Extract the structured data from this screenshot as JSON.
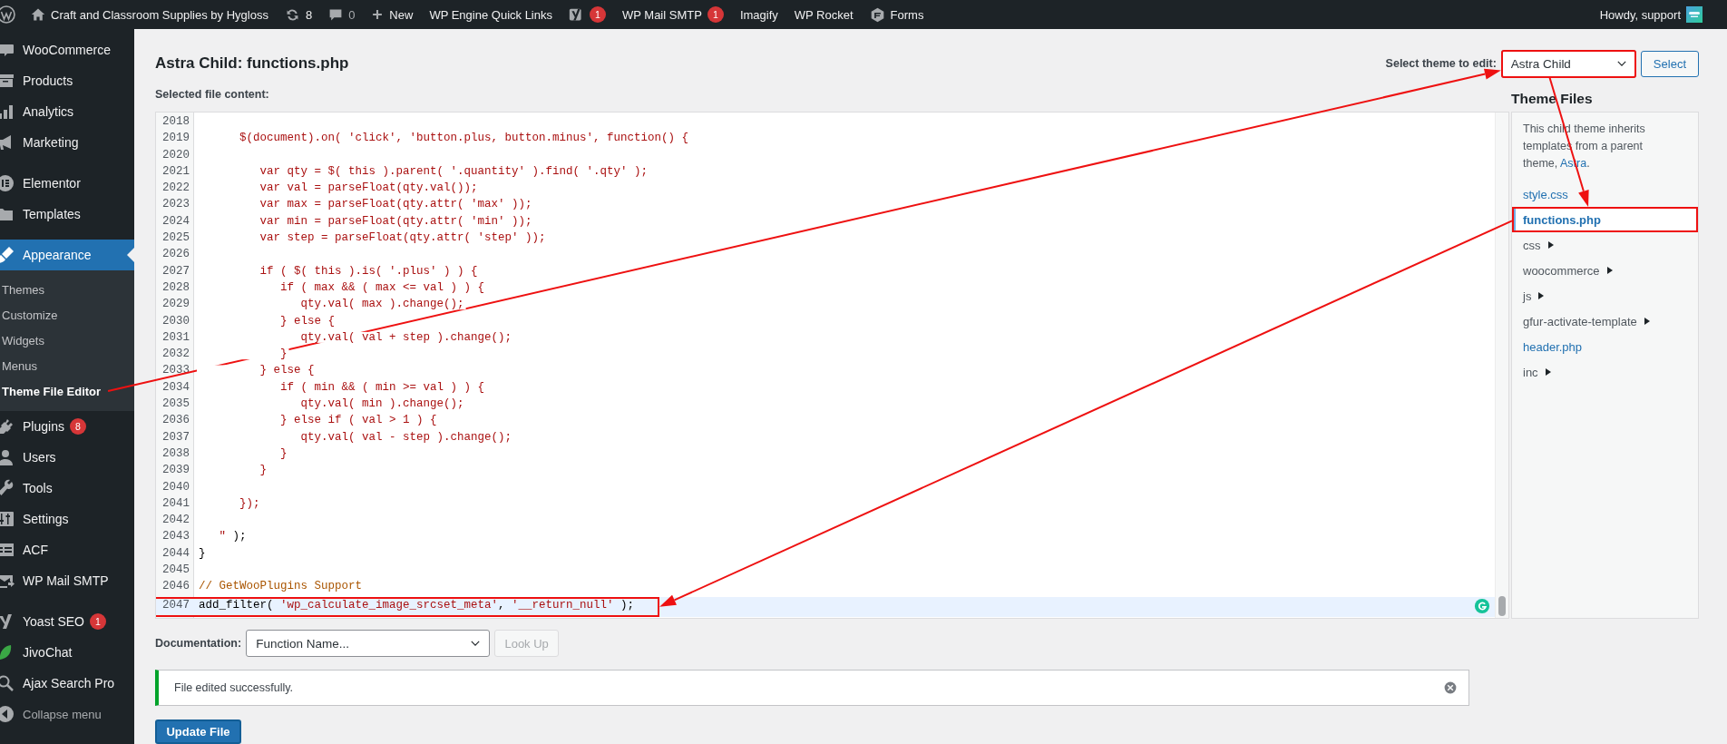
{
  "admin_bar": {
    "site_name": "Craft and Classroom Supplies by Hygloss",
    "updates": "8",
    "comments": "0",
    "new_label": "New",
    "menu": [
      {
        "label": "WP Engine Quick Links"
      },
      {
        "badge": "1"
      },
      {
        "label": "WP Mail SMTP",
        "badge": "1"
      },
      {
        "label": "Imagify"
      },
      {
        "label": "WP Rocket"
      },
      {
        "label": "Forms"
      }
    ],
    "greeting": "Howdy, support"
  },
  "sidebar": {
    "sections": [
      {
        "items": [
          {
            "label": "WooCommerce",
            "selected": false
          },
          {
            "label": "Products",
            "selected": false
          },
          {
            "label": "Analytics",
            "selected": false
          },
          {
            "label": "Marketing",
            "selected": false
          }
        ]
      },
      {
        "items": [
          {
            "label": "Elementor",
            "selected": false
          },
          {
            "label": "Templates",
            "selected": false
          }
        ]
      },
      {
        "items": [
          {
            "label": "Appearance",
            "selected": true,
            "submenu": [
              {
                "label": "Themes",
                "selected": false
              },
              {
                "label": "Customize",
                "selected": false
              },
              {
                "label": "Widgets",
                "selected": false
              },
              {
                "label": "Menus",
                "selected": false
              },
              {
                "label": "Theme File Editor",
                "selected": true
              }
            ]
          },
          {
            "label": "Plugins",
            "selected": false,
            "badge": "8"
          },
          {
            "label": "Users",
            "selected": false
          },
          {
            "label": "Tools",
            "selected": false
          },
          {
            "label": "Settings",
            "selected": false
          },
          {
            "label": "ACF",
            "selected": false
          },
          {
            "label": "WP Mail SMTP",
            "selected": false
          }
        ]
      },
      {
        "items": [
          {
            "label": "Yoast SEO",
            "selected": false,
            "badge": "1"
          },
          {
            "label": "JivoChat",
            "selected": false
          },
          {
            "label": "Ajax Search Pro",
            "selected": false
          }
        ]
      }
    ],
    "collapse_label": "Collapse menu"
  },
  "page": {
    "title": "Astra Child: functions.php",
    "content_label": "Selected file content:",
    "theme_select": {
      "label": "Select theme to edit:",
      "value": "Astra Child",
      "highlighted": true
    },
    "select_button": "Select"
  },
  "editor": {
    "lines": [
      {
        "number": "2018",
        "active": false,
        "highlighted": false
      },
      {
        "number": "2019",
        "active": false,
        "highlighted": false,
        "segments": [
          {
            "kind": "string",
            "text": "      $(document).on( 'click', 'button.plus, button.minus', function() {"
          }
        ]
      },
      {
        "number": "2020",
        "active": false,
        "highlighted": false
      },
      {
        "number": "2021",
        "active": false,
        "highlighted": false,
        "segments": [
          {
            "kind": "string",
            "text": "         var qty = $( this ).parent( '.quantity' ).find( '.qty' );"
          }
        ]
      },
      {
        "number": "2022",
        "active": false,
        "highlighted": false,
        "segments": [
          {
            "kind": "string",
            "text": "         var val = parseFloat(qty.val());"
          }
        ]
      },
      {
        "number": "2023",
        "active": false,
        "highlighted": false,
        "segments": [
          {
            "kind": "string",
            "text": "         var max = parseFloat(qty.attr( 'max' ));"
          }
        ]
      },
      {
        "number": "2024",
        "active": false,
        "highlighted": false,
        "segments": [
          {
            "kind": "string",
            "text": "         var min = parseFloat(qty.attr( 'min' ));"
          }
        ]
      },
      {
        "number": "2025",
        "active": false,
        "highlighted": false,
        "segments": [
          {
            "kind": "string",
            "text": "         var step = parseFloat(qty.attr( 'step' ));"
          }
        ]
      },
      {
        "number": "2026",
        "active": false,
        "highlighted": false
      },
      {
        "number": "2027",
        "active": false,
        "highlighted": false,
        "segments": [
          {
            "kind": "string",
            "text": "         if ( $( this ).is( '.plus' ) ) {"
          }
        ]
      },
      {
        "number": "2028",
        "active": false,
        "highlighted": false,
        "segments": [
          {
            "kind": "string",
            "text": "            if ( max && ( max <= val ) ) {"
          }
        ]
      },
      {
        "number": "2029",
        "active": false,
        "highlighted": false,
        "segments": [
          {
            "kind": "string",
            "text": "               qty.val( max ).change();"
          }
        ]
      },
      {
        "number": "2030",
        "active": false,
        "highlighted": false,
        "segments": [
          {
            "kind": "string",
            "text": "            } else {"
          }
        ]
      },
      {
        "number": "2031",
        "active": false,
        "highlighted": false,
        "segments": [
          {
            "kind": "string",
            "text": "               qty.val( val + step ).change();"
          }
        ]
      },
      {
        "number": "2032",
        "active": false,
        "highlighted": false,
        "segments": [
          {
            "kind": "string",
            "text": "            }"
          }
        ]
      },
      {
        "number": "2033",
        "active": false,
        "highlighted": false,
        "segments": [
          {
            "kind": "string",
            "text": "         } else {"
          }
        ]
      },
      {
        "number": "2034",
        "active": false,
        "highlighted": false,
        "segments": [
          {
            "kind": "string",
            "text": "            if ( min && ( min >= val ) ) {"
          }
        ]
      },
      {
        "number": "2035",
        "active": false,
        "highlighted": false,
        "segments": [
          {
            "kind": "string",
            "text": "               qty.val( min ).change();"
          }
        ]
      },
      {
        "number": "2036",
        "active": false,
        "highlighted": false,
        "segments": [
          {
            "kind": "string",
            "text": "            } else if ( val > 1 ) {"
          }
        ]
      },
      {
        "number": "2037",
        "active": false,
        "highlighted": false,
        "segments": [
          {
            "kind": "string",
            "text": "               qty.val( val - step ).change();"
          }
        ]
      },
      {
        "number": "2038",
        "active": false,
        "highlighted": false,
        "segments": [
          {
            "kind": "string",
            "text": "            }"
          }
        ]
      },
      {
        "number": "2039",
        "active": false,
        "highlighted": false,
        "segments": [
          {
            "kind": "string",
            "text": "         }"
          }
        ]
      },
      {
        "number": "2040",
        "active": false,
        "highlighted": false
      },
      {
        "number": "2041",
        "active": false,
        "highlighted": false,
        "segments": [
          {
            "kind": "string",
            "text": "      });"
          }
        ]
      },
      {
        "number": "2042",
        "active": false,
        "highlighted": false
      },
      {
        "number": "2043",
        "active": false,
        "highlighted": false,
        "segments": [
          {
            "kind": "string",
            "text": "   \""
          },
          {
            "kind": "plain",
            "text": " );"
          }
        ]
      },
      {
        "number": "2044",
        "active": false,
        "highlighted": false,
        "segments": [
          {
            "kind": "plain",
            "text": "}"
          }
        ]
      },
      {
        "number": "2045",
        "active": false,
        "highlighted": false
      },
      {
        "number": "2046",
        "active": false,
        "highlighted": false,
        "segments": [
          {
            "kind": "comment",
            "text": "// GetWooPlugins Support"
          }
        ]
      },
      {
        "number": "2047",
        "active": true,
        "highlighted": true,
        "segments": [
          {
            "kind": "plain",
            "text": "add_filter( "
          },
          {
            "kind": "string",
            "text": "'wp_calculate_image_srcset_meta'"
          },
          {
            "kind": "plain",
            "text": ", "
          },
          {
            "kind": "string",
            "text": "'__return_null'"
          },
          {
            "kind": "plain",
            "text": " );"
          }
        ]
      }
    ]
  },
  "theme_files": {
    "title": "Theme Files",
    "note_before": "This child theme inherits templates from a parent theme, ",
    "note_link": "Astra",
    "note_after": ".",
    "files": [
      {
        "label": "style.css",
        "kind": "file",
        "selected": false,
        "highlighted": false
      },
      {
        "label": "functions.php",
        "kind": "file",
        "selected": true,
        "highlighted": true
      },
      {
        "label": "css",
        "kind": "folder",
        "expanded": false,
        "highlighted": false
      },
      {
        "label": "woocommerce",
        "kind": "folder",
        "expanded": false,
        "highlighted": false
      },
      {
        "label": "js",
        "kind": "folder",
        "expanded": false,
        "highlighted": false
      },
      {
        "label": "gfur-activate-template",
        "kind": "folder",
        "expanded": false,
        "highlighted": false
      },
      {
        "label": "header.php",
        "kind": "file",
        "selected": false,
        "highlighted": false
      },
      {
        "label": "inc",
        "kind": "folder",
        "expanded": false,
        "highlighted": false
      }
    ]
  },
  "documentation": {
    "label": "Documentation:",
    "value": "Function Name...",
    "button": "Look Up",
    "button_disabled": true
  },
  "notice": {
    "text": "File edited successfully.",
    "kind": "success"
  },
  "update_button": "Update File"
}
